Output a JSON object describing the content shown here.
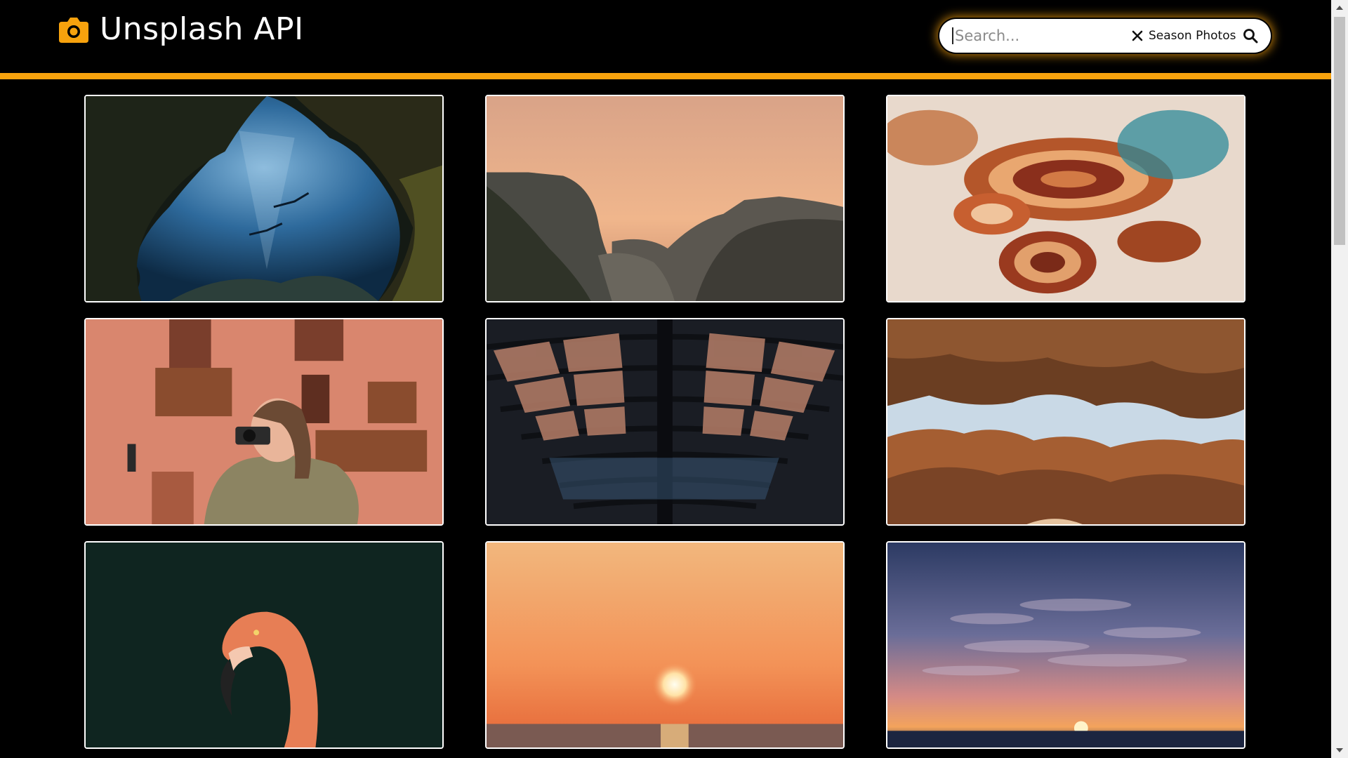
{
  "header": {
    "logo_text": "Unsplash API",
    "logo_icon": "camera-icon",
    "accent_color": "#f7a20d"
  },
  "search": {
    "placeholder": "Search...",
    "value": "",
    "clear_label": "Season Photos",
    "clear_icon": "close-icon",
    "submit_icon": "search-icon"
  },
  "photos": [
    {
      "subject": "underwater-cave-divers"
    },
    {
      "subject": "valley-sunset-cliffs"
    },
    {
      "subject": "colorful-agate-aerial"
    },
    {
      "subject": "woman-with-camera-pink-building"
    },
    {
      "subject": "arched-glass-roof"
    },
    {
      "subject": "cave-opening-rock"
    },
    {
      "subject": "flamingo-portrait"
    },
    {
      "subject": "ocean-sunset"
    },
    {
      "subject": "clouds-sunset-sea"
    }
  ]
}
